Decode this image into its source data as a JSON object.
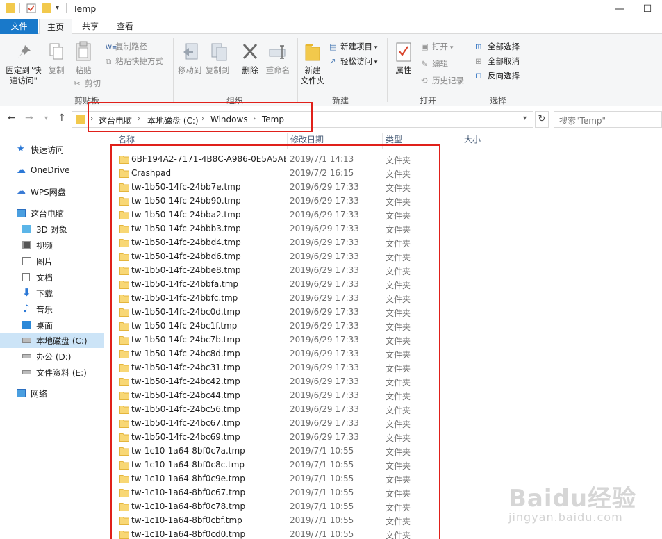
{
  "window": {
    "title": "Temp"
  },
  "tabs": [
    {
      "label": "文件"
    },
    {
      "label": "主页"
    },
    {
      "label": "共享"
    },
    {
      "label": "查看"
    }
  ],
  "ribbon": {
    "clipboard": {
      "pin_label_1": "固定到\"快",
      "pin_label_2": "速访问\"",
      "copy": "复制",
      "paste": "粘贴",
      "copy_path": "复制路径",
      "paste_shortcut": "粘贴快捷方式",
      "cut": "剪切",
      "group": "剪贴板"
    },
    "organize": {
      "move_to": "移动到",
      "copy_to": "复制到",
      "delete": "删除",
      "rename": "重命名",
      "group": "组织"
    },
    "new": {
      "new_folder_1": "新建",
      "new_folder_2": "文件夹",
      "new_item": "新建项目",
      "easy_access": "轻松访问",
      "group": "新建"
    },
    "open": {
      "properties": "属性",
      "open": "打开",
      "edit": "编辑",
      "history": "历史记录",
      "group": "打开"
    },
    "select": {
      "select_all": "全部选择",
      "select_none": "全部取消",
      "invert": "反向选择",
      "group": "选择"
    }
  },
  "address": {
    "crumbs": [
      "这台电脑",
      "本地磁盘 (C:)",
      "Windows",
      "Temp"
    ],
    "search_placeholder": "搜索\"Temp\""
  },
  "sidebar": {
    "items": [
      {
        "label": "快速访问"
      },
      {
        "label": "OneDrive"
      },
      {
        "label": "WPS网盘"
      },
      {
        "label": "这台电脑"
      },
      {
        "label": "3D 对象"
      },
      {
        "label": "视频"
      },
      {
        "label": "图片"
      },
      {
        "label": "文档"
      },
      {
        "label": "下载"
      },
      {
        "label": "音乐"
      },
      {
        "label": "桌面"
      },
      {
        "label": "本地磁盘 (C:)"
      },
      {
        "label": "办公 (D:)"
      },
      {
        "label": "文件资料 (E:)"
      },
      {
        "label": "网络"
      }
    ]
  },
  "columns": {
    "name": "名称",
    "date": "修改日期",
    "type": "类型",
    "size": "大小"
  },
  "files": [
    {
      "name": "6BF194A2-7171-4B8C-A986-0E5A5AE...",
      "date": "2019/7/1 14:13",
      "type": "文件夹"
    },
    {
      "name": "Crashpad",
      "date": "2019/7/2 16:15",
      "type": "文件夹"
    },
    {
      "name": "tw-1b50-14fc-24bb7e.tmp",
      "date": "2019/6/29 17:33",
      "type": "文件夹"
    },
    {
      "name": "tw-1b50-14fc-24bb90.tmp",
      "date": "2019/6/29 17:33",
      "type": "文件夹"
    },
    {
      "name": "tw-1b50-14fc-24bba2.tmp",
      "date": "2019/6/29 17:33",
      "type": "文件夹"
    },
    {
      "name": "tw-1b50-14fc-24bbb3.tmp",
      "date": "2019/6/29 17:33",
      "type": "文件夹"
    },
    {
      "name": "tw-1b50-14fc-24bbd4.tmp",
      "date": "2019/6/29 17:33",
      "type": "文件夹"
    },
    {
      "name": "tw-1b50-14fc-24bbd6.tmp",
      "date": "2019/6/29 17:33",
      "type": "文件夹"
    },
    {
      "name": "tw-1b50-14fc-24bbe8.tmp",
      "date": "2019/6/29 17:33",
      "type": "文件夹"
    },
    {
      "name": "tw-1b50-14fc-24bbfa.tmp",
      "date": "2019/6/29 17:33",
      "type": "文件夹"
    },
    {
      "name": "tw-1b50-14fc-24bbfc.tmp",
      "date": "2019/6/29 17:33",
      "type": "文件夹"
    },
    {
      "name": "tw-1b50-14fc-24bc0d.tmp",
      "date": "2019/6/29 17:33",
      "type": "文件夹"
    },
    {
      "name": "tw-1b50-14fc-24bc1f.tmp",
      "date": "2019/6/29 17:33",
      "type": "文件夹"
    },
    {
      "name": "tw-1b50-14fc-24bc7b.tmp",
      "date": "2019/6/29 17:33",
      "type": "文件夹"
    },
    {
      "name": "tw-1b50-14fc-24bc8d.tmp",
      "date": "2019/6/29 17:33",
      "type": "文件夹"
    },
    {
      "name": "tw-1b50-14fc-24bc31.tmp",
      "date": "2019/6/29 17:33",
      "type": "文件夹"
    },
    {
      "name": "tw-1b50-14fc-24bc42.tmp",
      "date": "2019/6/29 17:33",
      "type": "文件夹"
    },
    {
      "name": "tw-1b50-14fc-24bc44.tmp",
      "date": "2019/6/29 17:33",
      "type": "文件夹"
    },
    {
      "name": "tw-1b50-14fc-24bc56.tmp",
      "date": "2019/6/29 17:33",
      "type": "文件夹"
    },
    {
      "name": "tw-1b50-14fc-24bc67.tmp",
      "date": "2019/6/29 17:33",
      "type": "文件夹"
    },
    {
      "name": "tw-1b50-14fc-24bc69.tmp",
      "date": "2019/6/29 17:33",
      "type": "文件夹"
    },
    {
      "name": "tw-1c10-1a64-8bf0c7a.tmp",
      "date": "2019/7/1 10:55",
      "type": "文件夹"
    },
    {
      "name": "tw-1c10-1a64-8bf0c8c.tmp",
      "date": "2019/7/1 10:55",
      "type": "文件夹"
    },
    {
      "name": "tw-1c10-1a64-8bf0c9e.tmp",
      "date": "2019/7/1 10:55",
      "type": "文件夹"
    },
    {
      "name": "tw-1c10-1a64-8bf0c67.tmp",
      "date": "2019/7/1 10:55",
      "type": "文件夹"
    },
    {
      "name": "tw-1c10-1a64-8bf0c78.tmp",
      "date": "2019/7/1 10:55",
      "type": "文件夹"
    },
    {
      "name": "tw-1c10-1a64-8bf0cbf.tmp",
      "date": "2019/7/1 10:55",
      "type": "文件夹"
    },
    {
      "name": "tw-1c10-1a64-8bf0cd0.tmp",
      "date": "2019/7/1 10:55",
      "type": "文件夹"
    }
  ],
  "watermark": {
    "line1": "Baidu经验",
    "line2": "jingyan.baidu.com"
  },
  "colors": {
    "accent": "#1979ca",
    "highlight": "#e0201a",
    "selected": "#cce4f7",
    "folder": "#f2c94c"
  }
}
